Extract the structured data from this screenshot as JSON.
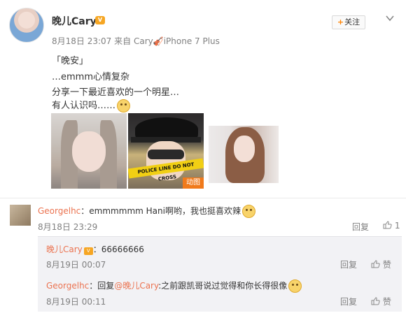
{
  "post": {
    "author": "晚儿Cary",
    "time": "8月18日 23:07",
    "via_prefix": "来自",
    "device": "Cary🎻iPhone 7 Plus",
    "follow_label": "关注",
    "lines": [
      "「晚安」",
      "…emmm心情复杂",
      "分享一下最近喜欢的一个明星…",
      "有人认识吗……"
    ],
    "images": [
      {
        "name": "photo-1"
      },
      {
        "name": "photo-2",
        "badge": "动图",
        "tape_text": "POLICE LINE DO NOT CROSS"
      },
      {
        "name": "photo-3"
      }
    ]
  },
  "comment": {
    "user": "Georgelhc",
    "text": "：emmmmmm Hani啊哟，我也挺喜欢辣",
    "time": "8月18日 23:29",
    "reply_label": "回复",
    "like_count": "1"
  },
  "replies": [
    {
      "user": "晚儿Cary",
      "text": "：66666666",
      "time": "8月19日 00:07",
      "reply_label": "回复",
      "like_label": "赞"
    },
    {
      "user": "Georgelhc",
      "text_prefix": "：回复",
      "mention": "@晚儿Cary",
      "text": ":之前跟凯哥说过觉得和你长得很像",
      "time": "8月19日 00:11",
      "reply_label": "回复",
      "like_label": "赞"
    }
  ],
  "colors": {
    "accent_orange": "#ff8200",
    "username": "#eb7350",
    "meta_gray": "#808080",
    "reply_bg": "#f2f2f5"
  }
}
